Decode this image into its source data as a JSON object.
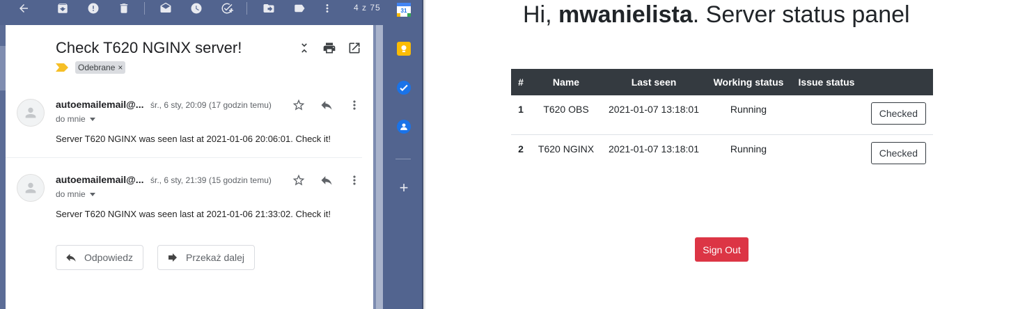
{
  "gmail": {
    "toolbar": {
      "icons": [
        "back-arrow-icon",
        "archive-icon",
        "report-spam-icon",
        "delete-icon",
        "mark-unread-icon",
        "snooze-icon",
        "add-task-icon",
        "move-to-icon",
        "label-icon",
        "more-icon"
      ],
      "count_label": "4 z 75"
    },
    "subject": "Check T620 NGINX server!",
    "subject_icons": [
      "collapse-all-icon",
      "print-icon",
      "open-new-window-icon"
    ],
    "label_chip": "Odebrane",
    "label_chip_close": "×",
    "messages": [
      {
        "sender": "autoemailemail@...",
        "date": "śr., 6 sty, 20:09 (17 godzin temu)",
        "to": "do mnie",
        "body": "Server T620 NGINX was seen last at 2021-01-06 20:06:01. Check it!"
      },
      {
        "sender": "autoemailemail@...",
        "date": "śr., 6 sty, 21:39 (15 godzin temu)",
        "to": "do mnie",
        "body": "Server T620 NGINX was seen last at 2021-01-06 21:33:02. Check it!"
      }
    ],
    "actions": {
      "reply": "Odpowiedz",
      "forward": "Przekaż dalej"
    },
    "side_panel": {
      "calendar_day": "31",
      "add_label": "+"
    }
  },
  "status_page": {
    "greeting_prefix": "Hi, ",
    "username": "mwanielista",
    "greeting_suffix": ". Server status panel",
    "table": {
      "headers": [
        "#",
        "Name",
        "Last seen",
        "Working status",
        "Issue status",
        ""
      ],
      "rows": [
        {
          "num": "1",
          "name": "T620 OBS",
          "last_seen": "2021-01-07 13:18:01",
          "working_status": "Running",
          "issue_status": "",
          "action": "Checked"
        },
        {
          "num": "2",
          "name": "T620 NGINX",
          "last_seen": "2021-01-07 13:18:01",
          "working_status": "Running",
          "issue_status": "",
          "action": "Checked"
        }
      ]
    },
    "sign_out": "Sign Out",
    "colors": {
      "header_bg": "#343a40",
      "danger": "#dc3545"
    }
  }
}
